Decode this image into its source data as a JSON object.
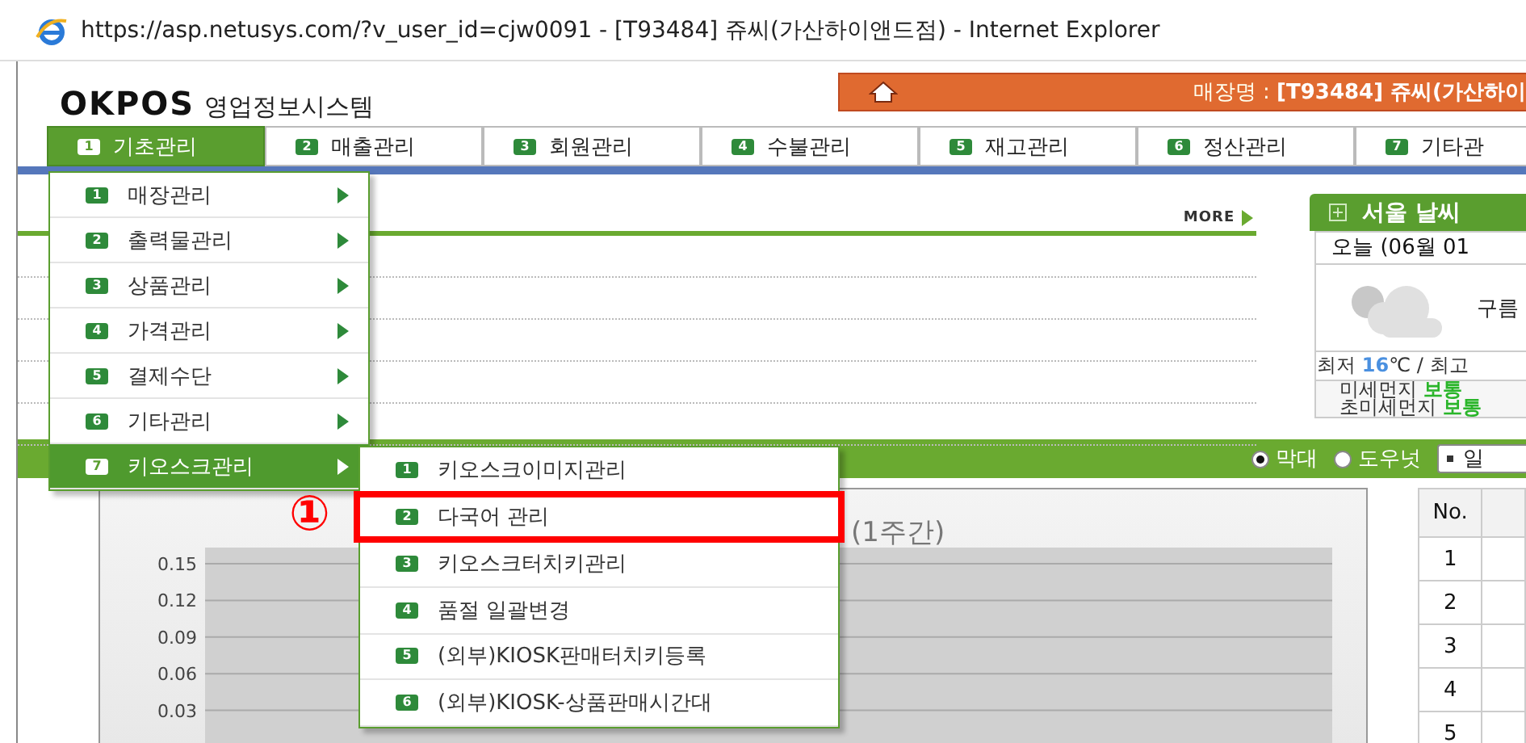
{
  "window": {
    "title": "https://asp.netusys.com/?v_user_id=cjw0091 - [T93484] 쥬씨(가산하이앤드점) - Internet Explorer"
  },
  "header": {
    "logo": "OKPOS",
    "system_name": "영업정보시스템",
    "store_label": "매장명 : ",
    "store_name": "[T93484] 쥬씨(가산하이"
  },
  "tabs": [
    {
      "num": "1",
      "label": "기초관리",
      "selected": true
    },
    {
      "num": "2",
      "label": "매출관리",
      "selected": false
    },
    {
      "num": "3",
      "label": "회원관리",
      "selected": false
    },
    {
      "num": "4",
      "label": "수불관리",
      "selected": false
    },
    {
      "num": "5",
      "label": "재고관리",
      "selected": false
    },
    {
      "num": "6",
      "label": "정산관리",
      "selected": false
    },
    {
      "num": "7",
      "label": "기타관",
      "selected": false
    }
  ],
  "notice": {
    "more": "MORE"
  },
  "menu": {
    "items": [
      {
        "num": "1",
        "label": "매장관리",
        "selected": false
      },
      {
        "num": "2",
        "label": "출력물관리",
        "selected": false
      },
      {
        "num": "3",
        "label": "상품관리",
        "selected": false
      },
      {
        "num": "4",
        "label": "가격관리",
        "selected": false
      },
      {
        "num": "5",
        "label": "결제수단",
        "selected": false
      },
      {
        "num": "6",
        "label": "기타관리",
        "selected": false
      },
      {
        "num": "7",
        "label": "키오스크관리",
        "selected": true
      }
    ]
  },
  "submenu": {
    "items": [
      {
        "num": "1",
        "label": "키오스크이미지관리",
        "highlighted": false
      },
      {
        "num": "2",
        "label": "다국어 관리",
        "highlighted": true
      },
      {
        "num": "3",
        "label": "키오스크터치키관리",
        "highlighted": false
      },
      {
        "num": "4",
        "label": "품절 일괄변경",
        "highlighted": false
      },
      {
        "num": "5",
        "label": "(외부)KIOSK판매터치키등록",
        "highlighted": false
      },
      {
        "num": "6",
        "label": "(외부)KIOSK-상품판매시간대",
        "highlighted": false
      }
    ]
  },
  "annotation": {
    "label": "①"
  },
  "chart_toolbar": {
    "options": [
      {
        "label": "막대",
        "selected": true
      },
      {
        "label": "도우넛",
        "selected": false
      }
    ],
    "period_select": "일"
  },
  "chart": {
    "title": "(1주간)",
    "y_labels": [
      "0.15",
      "0.12",
      "0.09",
      "0.06",
      "0.03"
    ]
  },
  "weather": {
    "title": "서울 날씨",
    "date": "오늘 (06월 01",
    "condition": "구름",
    "temp_low_label": "최저 ",
    "temp_low": "16",
    "temp_rest": "℃ / 최고",
    "dust": [
      {
        "label": "미세먼지 ",
        "value": "보통"
      },
      {
        "label": "초미세먼지 ",
        "value": "보통"
      }
    ]
  },
  "ranking_table": {
    "columns": [
      "No."
    ],
    "rows": [
      "1",
      "2",
      "3",
      "4",
      "5"
    ]
  }
}
